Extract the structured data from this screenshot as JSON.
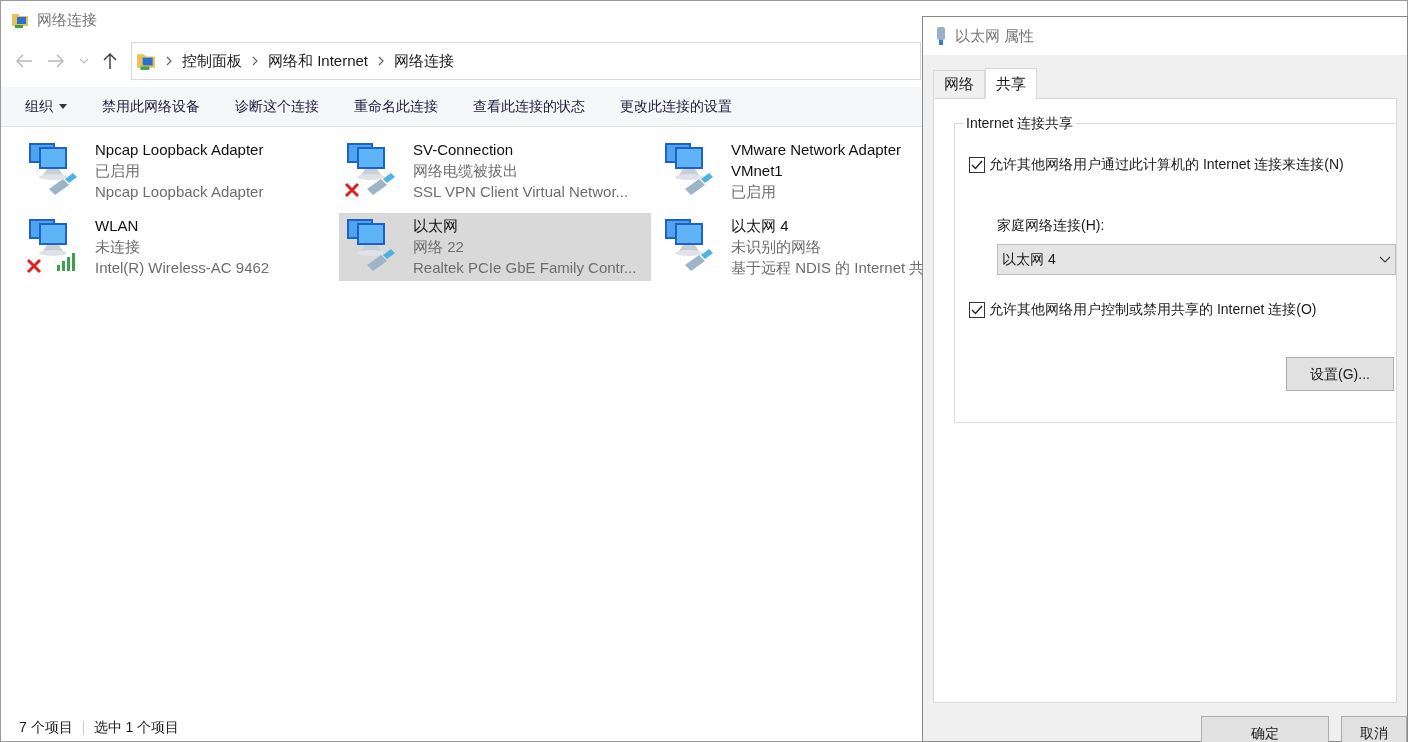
{
  "window": {
    "title": "网络连接"
  },
  "breadcrumb": [
    "控制面板",
    "网络和 Internet",
    "网络连接"
  ],
  "commands": [
    {
      "label": "组织",
      "dropdown": true
    },
    {
      "label": "禁用此网络设备",
      "dropdown": false
    },
    {
      "label": "诊断这个连接",
      "dropdown": false
    },
    {
      "label": "重命名此连接",
      "dropdown": false
    },
    {
      "label": "查看此连接的状态",
      "dropdown": false
    },
    {
      "label": "更改此连接的设置",
      "dropdown": false
    }
  ],
  "connections": [
    {
      "name": "Npcap Loopback Adapter",
      "status": "已启用",
      "device": "Npcap Loopback Adapter",
      "kind": "wired",
      "disconnected": false,
      "selected": false
    },
    {
      "name": "SV-Connection",
      "status": "网络电缆被拔出",
      "device": "SSL VPN Client Virtual Networ...",
      "kind": "wired",
      "disconnected": true,
      "selected": false
    },
    {
      "name": "VMware Network Adapter VMnet1",
      "status": "已启用",
      "kind": "wired",
      "disconnected": false,
      "selected": false
    },
    {
      "name": "WLAN",
      "status": "未连接",
      "device": "Intel(R) Wireless-AC 9462",
      "kind": "wireless",
      "disconnected": true,
      "selected": false
    },
    {
      "name": "以太网",
      "status": "网络 22",
      "device": "Realtek PCIe GbE Family Contr...",
      "kind": "wired",
      "disconnected": false,
      "selected": true
    },
    {
      "name": "以太网 4",
      "status": "未识别的网络",
      "device": "基于远程 NDIS 的 Internet 共",
      "kind": "wired",
      "disconnected": false,
      "selected": false
    }
  ],
  "status_bar": [
    "7 个项目",
    "选中 1 个项目"
  ],
  "dialog": {
    "title": "以太网 属性",
    "tabs": [
      {
        "label": "网络",
        "selected": false
      },
      {
        "label": "共享",
        "selected": true
      }
    ],
    "group_title": "Internet 连接共享",
    "allow_sharing": {
      "label": "允许其他网络用户通过此计算机的 Internet 连接来连接(N)",
      "checked": true
    },
    "home_network": {
      "label": "家庭网络连接(H):",
      "value": "以太网 4"
    },
    "allow_control": {
      "label": "允许其他网络用户控制或禁用共享的 Internet 连接(O)",
      "checked": true
    },
    "settings_button": "设置(G)...",
    "buttons": [
      "确定",
      "取消"
    ]
  }
}
